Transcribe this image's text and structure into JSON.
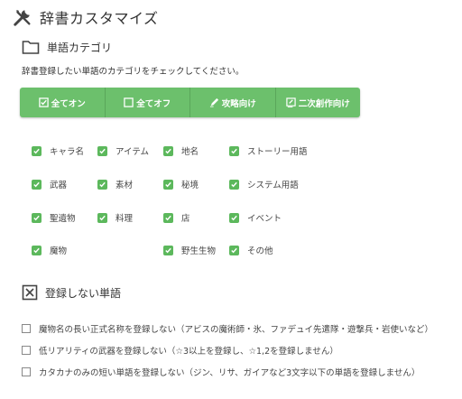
{
  "title": "辞書カスタマイズ",
  "section_category": {
    "label": "単語カテゴリ",
    "description": "辞書登録したい単語のカテゴリをチェックしてください。"
  },
  "buttons": [
    {
      "label": "全てオン",
      "icon": "checked-box-icon"
    },
    {
      "label": "全てオフ",
      "icon": "empty-box-icon"
    },
    {
      "label": "攻略向け",
      "icon": "pencil-icon"
    },
    {
      "label": "二次創作向け",
      "icon": "edit-note-icon"
    }
  ],
  "categories": [
    {
      "label": "キャラ名",
      "checked": true
    },
    {
      "label": "アイテム",
      "checked": true
    },
    {
      "label": "地名",
      "checked": true
    },
    {
      "label": "ストーリー用語",
      "checked": true
    },
    {
      "label": "武器",
      "checked": true
    },
    {
      "label": "素材",
      "checked": true
    },
    {
      "label": "秘境",
      "checked": true
    },
    {
      "label": "システム用語",
      "checked": true
    },
    {
      "label": "聖遺物",
      "checked": true
    },
    {
      "label": "料理",
      "checked": true
    },
    {
      "label": "店",
      "checked": true
    },
    {
      "label": "イベント",
      "checked": true
    },
    {
      "label": "魔物",
      "checked": true
    },
    {
      "label": "野生生物",
      "checked": true
    },
    {
      "label": "その他",
      "checked": true
    }
  ],
  "section_exclude": {
    "label": "登録しない単語"
  },
  "exclude_options": [
    {
      "label": "魔物名の長い正式名称を登録しない（アビスの魔術師・氷、ファデュイ先遣隊・遊撃兵・岩使いなど）",
      "checked": false
    },
    {
      "label": "低リアリティの武器を登録しない（☆3以上を登録し、☆1,2を登録しません）",
      "checked": false
    },
    {
      "label": "カタカナのみの短い単語を登録しない（ジン、リサ、ガイアなど3文字以下の単語を登録しません）",
      "checked": false
    }
  ],
  "colors": {
    "accent": "#6cc06c",
    "check": "#5cb85c"
  }
}
